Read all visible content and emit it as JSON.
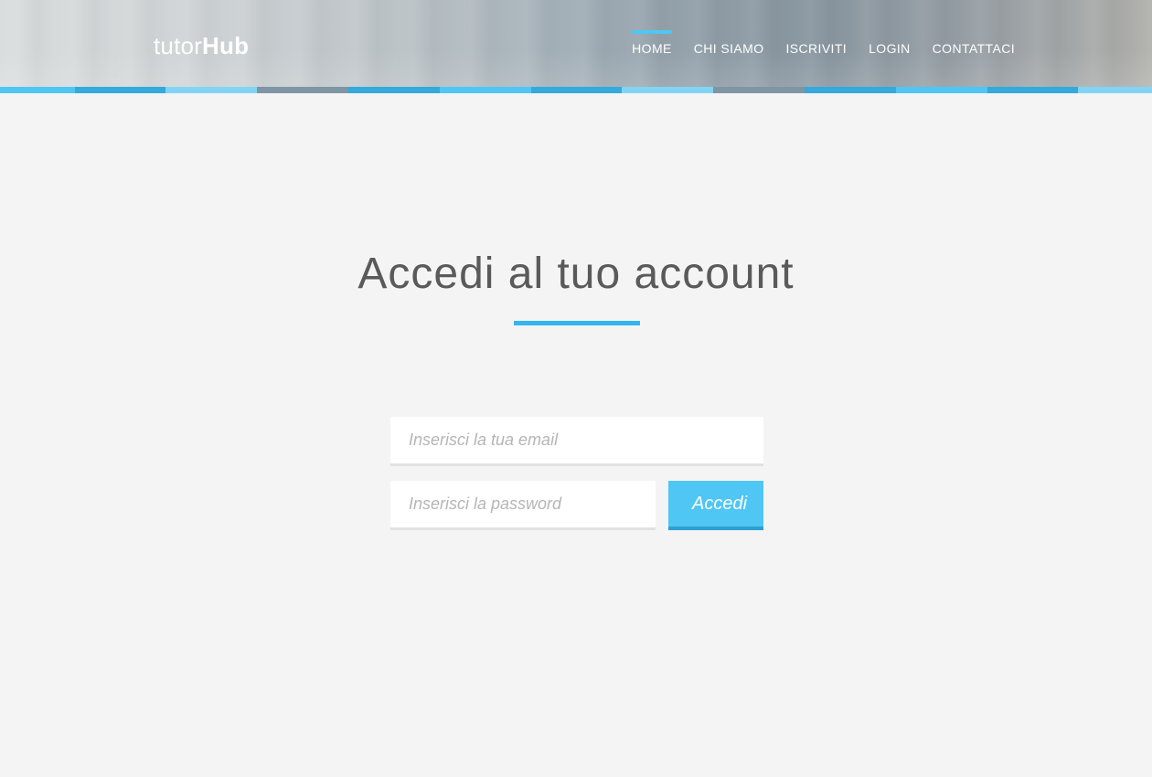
{
  "header": {
    "logo": {
      "light": "tutor",
      "bold": "Hub"
    },
    "nav": [
      {
        "label": "HOME",
        "active": true
      },
      {
        "label": "CHI SIAMO",
        "active": false
      },
      {
        "label": "ISCRIVITI",
        "active": false
      },
      {
        "label": "LOGIN",
        "active": false
      },
      {
        "label": "CONTATTACI",
        "active": false
      }
    ],
    "stripe_colors": [
      "#4fc6f3",
      "#34a9dc",
      "#82d4f5",
      "#7f95a3",
      "#34a9dc",
      "#4fc6f3",
      "#34a9dc",
      "#82d4f5",
      "#7f95a3",
      "#34a9dc",
      "#4fc6f3",
      "#34a9dc",
      "#82d4f5"
    ]
  },
  "main": {
    "title": "Accedi al tuo account",
    "accent_color": "#34b6ec",
    "form": {
      "email_placeholder": "Inserisci la tua email",
      "password_placeholder": "Inserisci la password",
      "submit_label": "Accedi"
    }
  }
}
